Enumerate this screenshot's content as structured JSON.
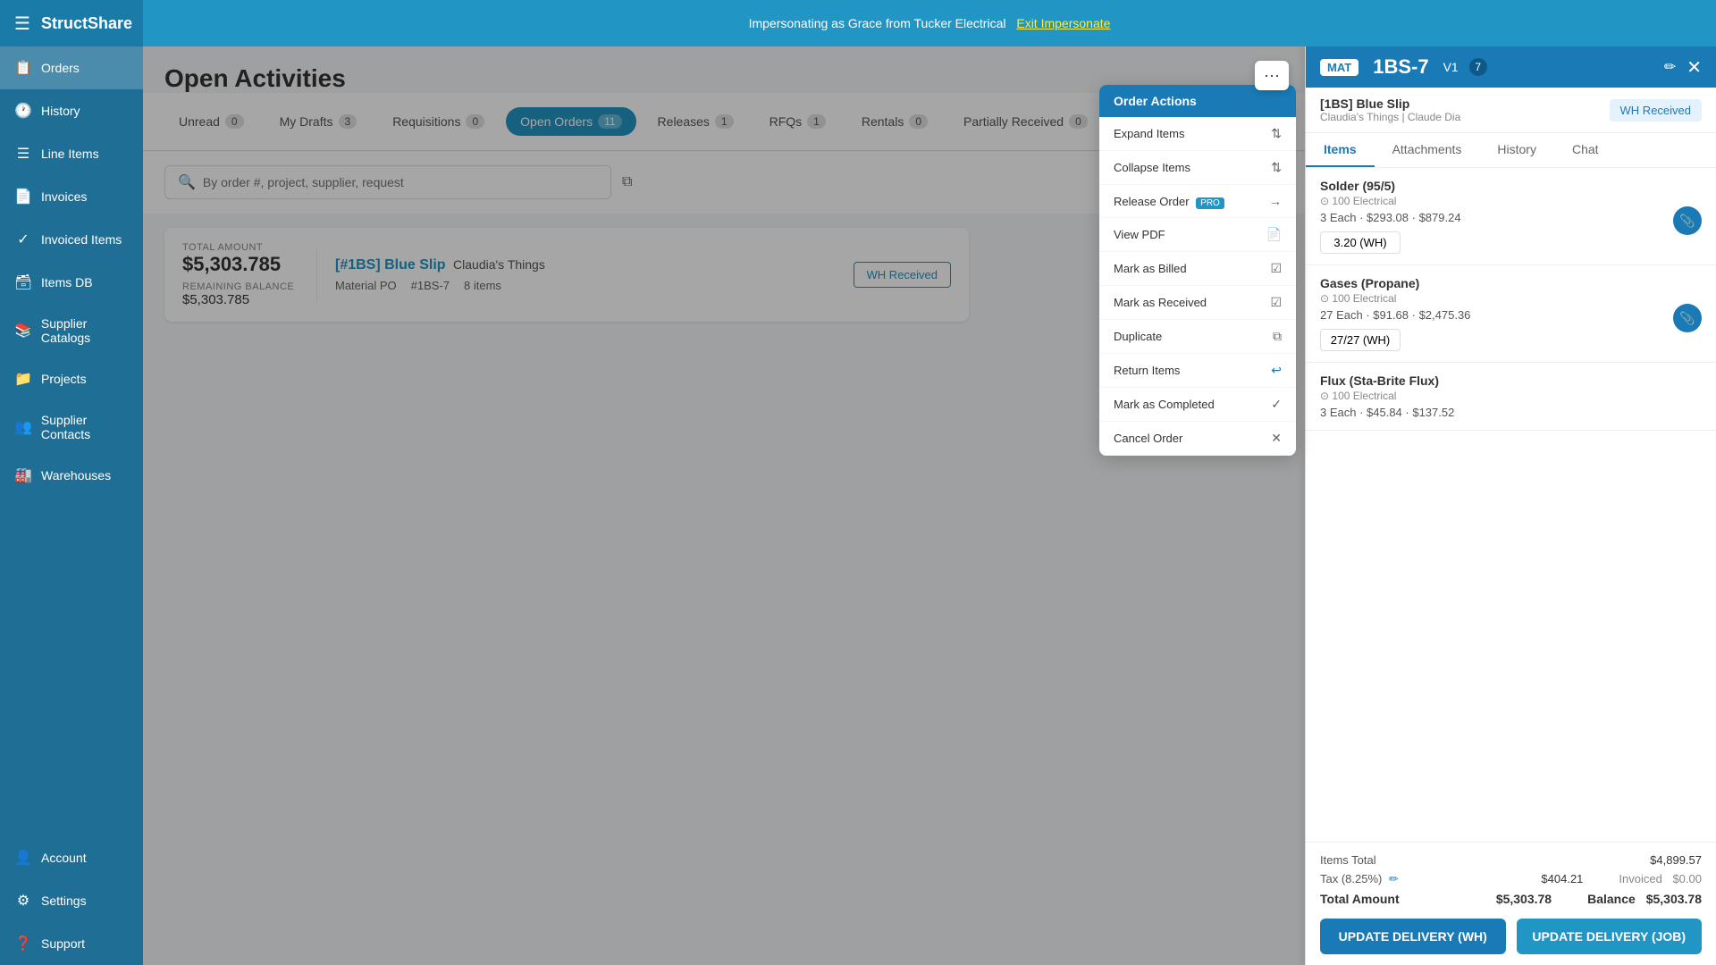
{
  "topbar": {
    "logo": "StructShare",
    "impersonate_text": "Impersonating as Grace from Tucker Electrical",
    "exit_label": "Exit Impersonate"
  },
  "sidebar": {
    "items": [
      {
        "id": "orders",
        "label": "Orders",
        "icon": "📋",
        "active": true
      },
      {
        "id": "history",
        "label": "History",
        "icon": "🕐"
      },
      {
        "id": "line-items",
        "label": "Line Items",
        "icon": "☰"
      },
      {
        "id": "invoices",
        "label": "Invoices",
        "icon": "📄"
      },
      {
        "id": "invoiced-items",
        "label": "Invoiced Items",
        "icon": "✓"
      },
      {
        "id": "items-db",
        "label": "Items DB",
        "icon": "🗃"
      },
      {
        "id": "supplier-catalogs",
        "label": "Supplier Catalogs",
        "icon": "📚"
      },
      {
        "id": "projects",
        "label": "Projects",
        "icon": "📁"
      },
      {
        "id": "supplier-contacts",
        "label": "Supplier Contacts",
        "icon": "👥"
      },
      {
        "id": "warehouses",
        "label": "Warehouses",
        "icon": "🏭"
      }
    ],
    "bottom_items": [
      {
        "id": "account",
        "label": "Account",
        "icon": "👤"
      },
      {
        "id": "settings",
        "label": "Settings",
        "icon": "⚙"
      },
      {
        "id": "support",
        "label": "Support",
        "icon": "❓"
      }
    ]
  },
  "page": {
    "title": "Open Activities"
  },
  "tabs": [
    {
      "id": "unread",
      "label": "Unread",
      "count": "0",
      "active": false
    },
    {
      "id": "my-drafts",
      "label": "My Drafts",
      "count": "3",
      "active": false
    },
    {
      "id": "requisitions",
      "label": "Requisitions",
      "count": "0",
      "active": false
    },
    {
      "id": "open-orders",
      "label": "Open Orders",
      "count": "11",
      "active": true
    },
    {
      "id": "releases",
      "label": "Releases",
      "count": "1",
      "active": false
    },
    {
      "id": "rfqs",
      "label": "RFQs",
      "count": "1",
      "active": false
    },
    {
      "id": "rentals",
      "label": "Rentals",
      "count": "0",
      "active": false
    },
    {
      "id": "partially-received",
      "label": "Partially Received",
      "count": "0",
      "active": false
    }
  ],
  "search": {
    "placeholder": "By order #, project, supplier, request"
  },
  "order_card": {
    "total_label": "TOTAL AMOUNT",
    "total_amount": "$5,303.785",
    "remaining_label": "REMAINING BALANCE",
    "remaining_amount": "$5,303.785",
    "title": "[#1BS] Blue Slip",
    "supplier": "Claudia's Things",
    "type": "Material PO",
    "number": "#1BS-7",
    "items": "8 items",
    "wh_received": "WH Received"
  },
  "order_actions_menu": {
    "title": "Order Actions",
    "items": [
      {
        "label": "Expand Items",
        "icon": "↕",
        "disabled": false
      },
      {
        "label": "Collapse Items",
        "icon": "↕",
        "disabled": false
      },
      {
        "label": "Release Order",
        "icon": "→",
        "tag": "PRO",
        "disabled": false
      },
      {
        "label": "View PDF",
        "icon": "📄",
        "disabled": false
      },
      {
        "label": "Mark as Billed",
        "icon": "✓",
        "disabled": false
      },
      {
        "label": "Mark as Received",
        "icon": "✓",
        "disabled": false
      },
      {
        "label": "Duplicate",
        "icon": "⧉",
        "disabled": false
      },
      {
        "label": "Return Items",
        "icon": "↩",
        "disabled": false
      },
      {
        "label": "Mark as Completed",
        "icon": "✓",
        "disabled": false
      },
      {
        "label": "Cancel Order",
        "icon": "✕",
        "disabled": false
      }
    ]
  },
  "panel": {
    "badge": "MAT",
    "order_number": "1BS-7",
    "version": "V1",
    "version_num": "7",
    "supplier_name": "[1BS] Blue Slip",
    "supplier_sub": "Claudia's Things | Claude Dia",
    "wh_received_btn": "WH Received",
    "tabs": [
      "Items",
      "Attachments",
      "History",
      "Chat"
    ],
    "active_tab": "Items",
    "items": [
      {
        "name": "Solder (95/5)",
        "supplier_info": "100 Electrical",
        "details": "3 Each · $293.08 · $879.24",
        "qty_display": "3.20 (WH)",
        "has_attach": true
      },
      {
        "name": "Gases (Propane)",
        "supplier_info": "100 Electrical",
        "details": "27 Each · $91.68 · $2,475.36",
        "qty_display": "27/27 (WH)",
        "has_attach": true
      },
      {
        "name": "Flux (Sta-Brite Flux)",
        "supplier_info": "100 Electrical",
        "details": "3 Each · $45.84 · $137.52",
        "qty_display": "",
        "has_attach": false
      }
    ],
    "footer": {
      "items_total_label": "Items Total",
      "items_total": "$4,899.57",
      "tax_label": "Tax (8.25%)",
      "tax_amount": "$404.21",
      "invoiced_label": "Invoiced",
      "invoiced_amount": "$0.00",
      "total_label": "Total Amount",
      "total_amount": "$5,303.78",
      "balance_label": "Balance",
      "balance_amount": "$5,303.78"
    },
    "actions": {
      "update_wh": "UPDATE DELIVERY (WH)",
      "update_job": "UPDATE DELIVERY (JOB)"
    }
  }
}
